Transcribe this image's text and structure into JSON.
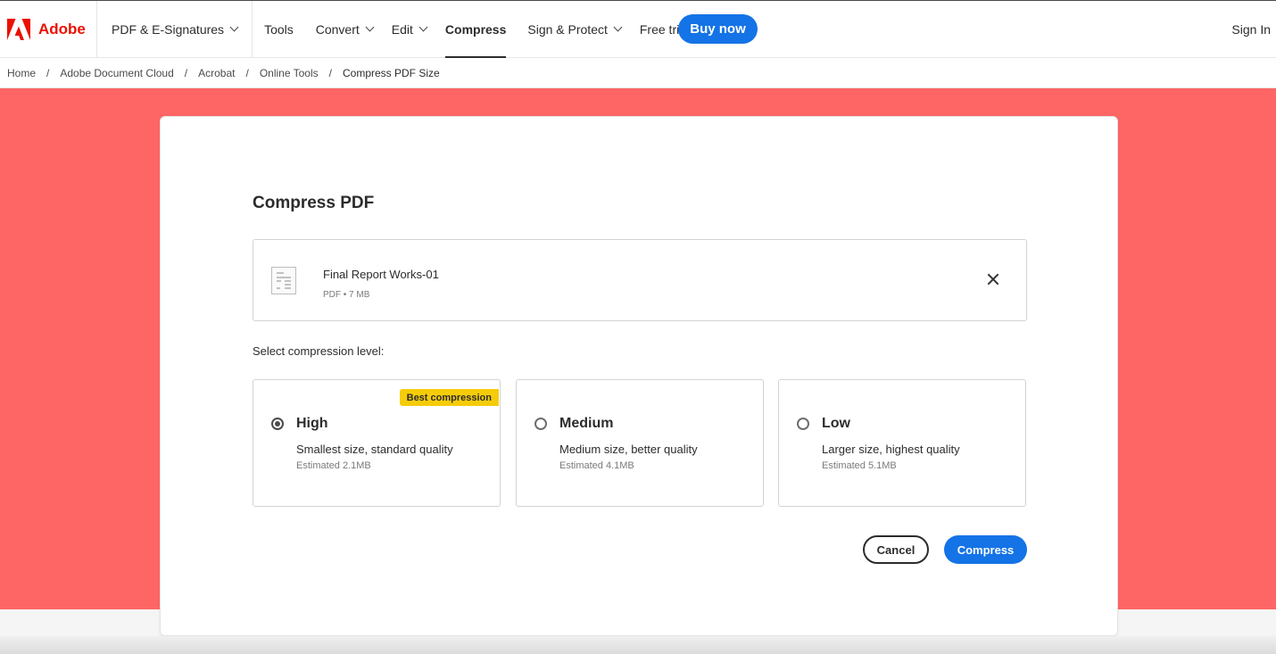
{
  "nav": {
    "brand": "Adobe",
    "items": [
      {
        "label": "PDF & E-Signatures",
        "dropdown": true
      },
      {
        "label": "Tools",
        "dropdown": false
      },
      {
        "label": "Convert",
        "dropdown": true
      },
      {
        "label": "Edit",
        "dropdown": true
      },
      {
        "label": "Compress",
        "dropdown": false,
        "active": true
      },
      {
        "label": "Sign & Protect",
        "dropdown": true
      },
      {
        "label": "Free trial",
        "dropdown": false
      }
    ],
    "buy_label": "Buy now",
    "signin_label": "Sign In"
  },
  "breadcrumb": [
    "Home",
    "Adobe Document Cloud",
    "Acrobat",
    "Online Tools",
    "Compress PDF Size"
  ],
  "dialog": {
    "title": "Compress PDF",
    "file": {
      "name": "Final Report Works-01",
      "meta": "PDF • 7 MB"
    },
    "select_label": "Select compression level:",
    "options": [
      {
        "title": "High",
        "desc": "Smallest size, standard quality",
        "estimate": "Estimated 2.1MB",
        "badge": "Best compression",
        "selected": true
      },
      {
        "title": "Medium",
        "desc": "Medium size, better quality",
        "estimate": "Estimated 4.1MB",
        "selected": false
      },
      {
        "title": "Low",
        "desc": "Larger size, highest quality",
        "estimate": "Estimated 5.1MB",
        "selected": false
      }
    ],
    "cancel_label": "Cancel",
    "compress_label": "Compress"
  },
  "colors": {
    "brand": "#eb1000",
    "accent": "#1473e6",
    "hero": "#fe6565",
    "badge": "#f6cc0a"
  }
}
